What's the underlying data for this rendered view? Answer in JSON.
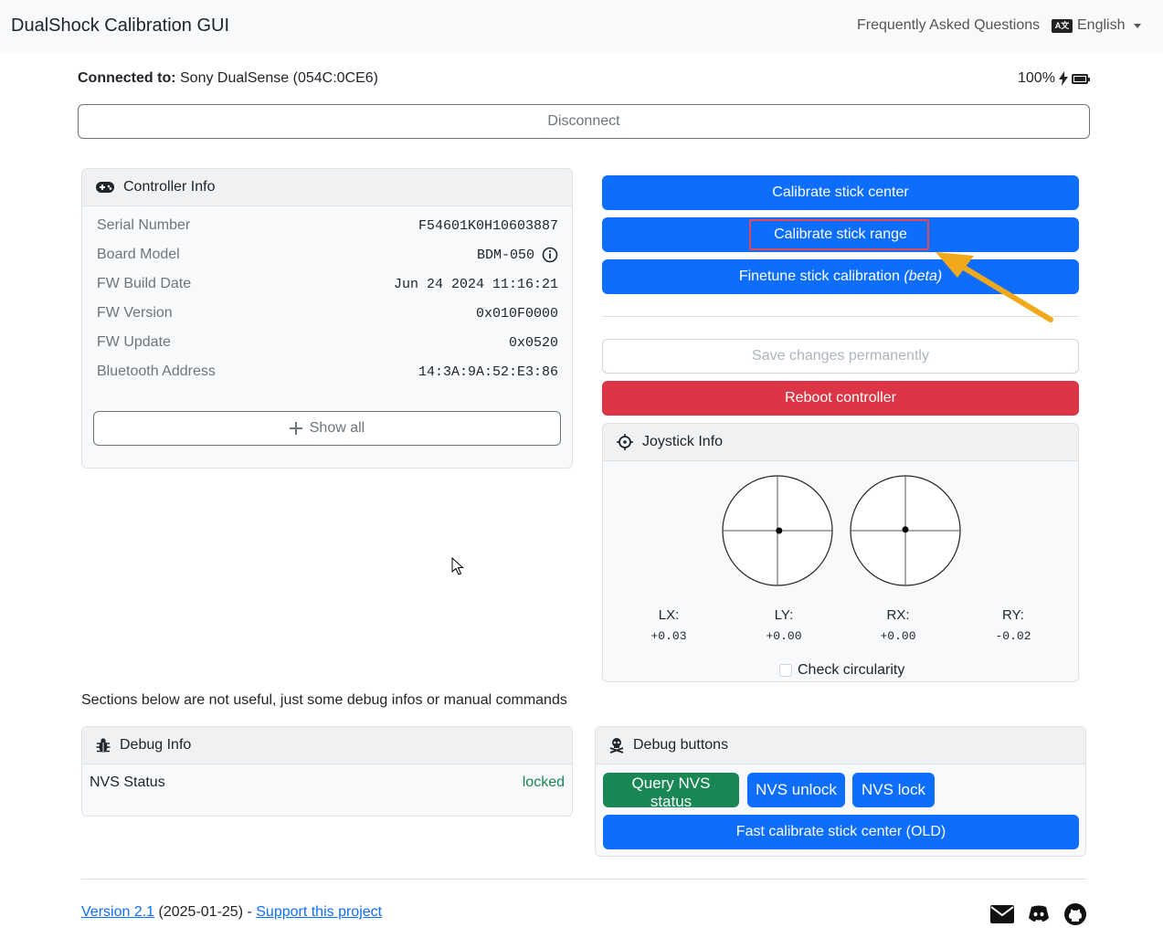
{
  "navbar": {
    "brand": "DualShock Calibration GUI",
    "faq": "Frequently Asked Questions",
    "language_icon_text": "A文",
    "language": "English"
  },
  "connection": {
    "label": "Connected to:",
    "device": "Sony DualSense (054C:0CE6)",
    "battery_percent": "100%",
    "battery_level": 1.0,
    "disconnect": "Disconnect"
  },
  "controller_info": {
    "title": "Controller Info",
    "rows": [
      {
        "label": "Serial Number",
        "value": "F54601K0H10603887"
      },
      {
        "label": "Board Model",
        "value": "BDM-050"
      },
      {
        "label": "FW Build Date",
        "value": "Jun 24 2024 11:16:21"
      },
      {
        "label": "FW Version",
        "value": "0x010F0000"
      },
      {
        "label": "FW Update",
        "value": "0x0520"
      },
      {
        "label": "Bluetooth Address",
        "value": "14:3A:9A:52:E3:86"
      }
    ],
    "show_all": "Show all"
  },
  "actions": {
    "calibrate_center": "Calibrate stick center",
    "calibrate_range": "Calibrate stick range",
    "finetune": "Finetune stick calibration",
    "finetune_suffix": "(beta)",
    "save": "Save changes permanently",
    "reboot": "Reboot controller"
  },
  "joystick_info": {
    "title": "Joystick Info",
    "labels": [
      "LX:",
      "LY:",
      "RX:",
      "RY:"
    ],
    "values": [
      "+0.03",
      "+0.00",
      "+0.00",
      "-0.02"
    ],
    "check_circularity": "Check circularity"
  },
  "debug_note": "Sections below are not useful, just some debug infos or manual commands",
  "debug_info": {
    "title": "Debug Info",
    "nvs_label": "NVS Status",
    "nvs_value": "locked"
  },
  "debug_buttons": {
    "title": "Debug buttons",
    "query": "Query NVS status",
    "unlock": "NVS unlock",
    "lock": "NVS lock",
    "fast_calibrate": "Fast calibrate stick center (OLD)"
  },
  "footer": {
    "version": "Version 2.1",
    "date": "(2025-01-25)",
    "separator": "-",
    "support": "Support this project"
  },
  "colors": {
    "primary": "#0d6efd",
    "danger": "#dc3545",
    "success": "#198754",
    "annotation_arrow": "#f0a81c",
    "highlight_box": "#e04a5a"
  }
}
